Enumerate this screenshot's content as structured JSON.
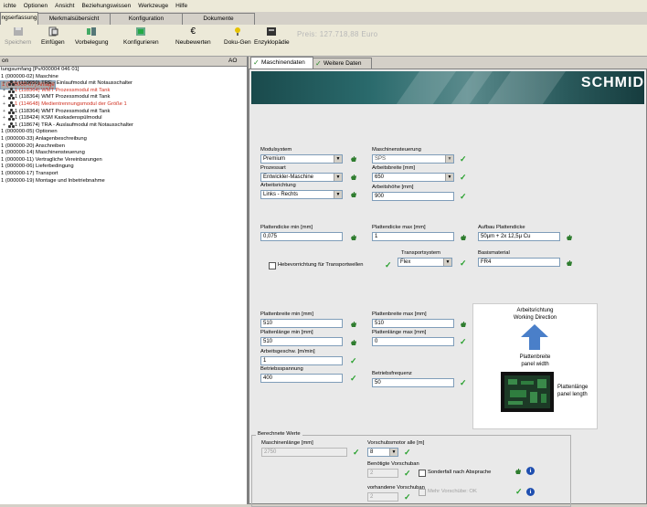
{
  "menu": [
    "ichte",
    "Optionen",
    "Ansicht",
    "Beziehungswissen",
    "Werkzeuge",
    "Hilfe"
  ],
  "top_tabs": [
    "ngserfassung",
    "Merkmalsübersicht",
    "Konfiguration",
    "Dokumente"
  ],
  "toolbar": {
    "buttons": [
      {
        "label": "Speichern",
        "icon": "save-icon",
        "disabled": true
      },
      {
        "label": "Einfügen",
        "icon": "insert-icon",
        "disabled": false
      },
      {
        "label": "Vorbelegung",
        "icon": "preset-icon",
        "disabled": false
      },
      {
        "label": "Konfigurieren",
        "icon": "configure-icon",
        "disabled": false
      },
      {
        "label": "Neubewerten",
        "icon": "euro-icon",
        "disabled": false
      },
      {
        "label": "Doku-Gen",
        "icon": "docgen-icon",
        "disabled": false
      },
      {
        "label": "Enzyklopädie",
        "icon": "encyclopedia-icon",
        "disabled": false
      }
    ],
    "price": "Preis: 127.718,88 Euro"
  },
  "left_pane": {
    "header_left": "on",
    "header_right": "AO",
    "tree": [
      {
        "text": "tungsumfang [Pv/000004 046 01]",
        "indent": 0,
        "expander": "",
        "node_icon": false,
        "red": false,
        "selected": false
      },
      {
        "text": "1 (000000-02) Maschine",
        "indent": 0,
        "expander": "",
        "node_icon": false,
        "red": false,
        "selected": false
      },
      {
        "text": "1 (000000-07) Anlage",
        "indent": 0,
        "expander": "",
        "node_icon": false,
        "red": true,
        "selected": true
      },
      {
        "text": "1 (118659) TRE - Einlaufmodul mit Notausschalter",
        "indent": 1,
        "expander": "+",
        "node_icon": true,
        "red": false,
        "selected": false
      },
      {
        "text": "1 (118364) WMT Prozessmodul mit Tank",
        "indent": 1,
        "expander": "+",
        "node_icon": true,
        "red": true,
        "selected": false
      },
      {
        "text": "1 (118364) WMT Prozessmodul mit Tank",
        "indent": 1,
        "expander": "+",
        "node_icon": true,
        "red": false,
        "selected": false
      },
      {
        "text": "1 (114648) Medientrennungsmodul der Größe 1",
        "indent": 1,
        "expander": "+",
        "node_icon": true,
        "red": true,
        "selected": false
      },
      {
        "text": "1 (118364) WMT Prozessmodul mit Tank",
        "indent": 1,
        "expander": "+",
        "node_icon": true,
        "red": false,
        "selected": false
      },
      {
        "text": "1 (118424) KSM Kaskadenspülmodul",
        "indent": 1,
        "expander": "+",
        "node_icon": true,
        "red": false,
        "selected": false
      },
      {
        "text": "1 (118674) TRA - Auslaufmodul mit Notausschalter",
        "indent": 1,
        "expander": "+",
        "node_icon": true,
        "red": false,
        "selected": false
      },
      {
        "text": "1 (000000-05) Optionen",
        "indent": 0,
        "expander": "",
        "node_icon": false,
        "red": false,
        "selected": false
      },
      {
        "text": "1 (000000-33) Anlagenbeschreibung",
        "indent": 0,
        "expander": "",
        "node_icon": false,
        "red": false,
        "selected": false
      },
      {
        "text": "1 (000000-20) Anschreiben",
        "indent": 0,
        "expander": "",
        "node_icon": false,
        "red": false,
        "selected": false
      },
      {
        "text": "1 (000000-14) Maschinensteuerung",
        "indent": 0,
        "expander": "",
        "node_icon": false,
        "red": false,
        "selected": false
      },
      {
        "text": "1 (000000-11) Vertragliche Vereinbarungen",
        "indent": 0,
        "expander": "",
        "node_icon": false,
        "red": false,
        "selected": false
      },
      {
        "text": "1 (000000-06) Lieferbedingung",
        "indent": 0,
        "expander": "",
        "node_icon": false,
        "red": false,
        "selected": false
      },
      {
        "text": "1 (000000-17) Transport",
        "indent": 0,
        "expander": "",
        "node_icon": false,
        "red": false,
        "selected": false
      },
      {
        "text": "1 (000000-19) Montage und Inbetriebnahme",
        "indent": 0,
        "expander": "",
        "node_icon": false,
        "red": false,
        "selected": false
      }
    ]
  },
  "right_tabs": [
    "Maschinendaten",
    "Weitere Daten"
  ],
  "banner_logo": "SCHMID",
  "form": {
    "modulsystem": {
      "label": "Modulsystem",
      "value": "Premium"
    },
    "maschinensteuerung": {
      "label": "Maschinensteuerung",
      "value": "SPS"
    },
    "prozessart": {
      "label": "Prozessart",
      "value": "Entwickler-Maschine"
    },
    "arbeitsbreite": {
      "label": "Arbeitsbreite [mm]",
      "value": "650"
    },
    "arbeitsrichtung": {
      "label": "Arbeitsrichtung",
      "value": "Links - Rechts"
    },
    "arbeitshoehe": {
      "label": "Arbeitshöhe [mm]",
      "value": "900"
    },
    "plattendicke_min": {
      "label": "Plattendicke min [mm]",
      "value": "0,075"
    },
    "plattendicke_max": {
      "label": "Plattendicke max [mm]",
      "value": "1"
    },
    "aufbau_plattendicke": {
      "label": "Aufbau Plattendicke",
      "value": "50µm + 2x 12,5µ Cu"
    },
    "hebevorrichtung": {
      "label": "Hebevorrichtung für Transportwellen"
    },
    "transportsystem": {
      "label": "Transportsystem",
      "value": "Flex"
    },
    "basismaterial": {
      "label": "Basismaterial",
      "value": "FR4"
    },
    "plattenbreite_min": {
      "label": "Plattenbreite min [mm]",
      "value": "510"
    },
    "plattenbreite_max": {
      "label": "Plattenbreite max [mm]",
      "value": "510"
    },
    "plattenlaenge_min": {
      "label": "Plattenlänge min [mm]",
      "value": "510"
    },
    "plattenlaenge_max": {
      "label": "Plattenlänge max [mm]",
      "value": "0"
    },
    "arbeitsgeschw": {
      "label": "Arbeitsgeschw. [m/min]",
      "value": "1"
    },
    "betriebsspannung": {
      "label": "Betriebsspannung",
      "value": "400"
    },
    "betriebsfrequenz": {
      "label": "Betriebsfrequenz",
      "value": "50"
    }
  },
  "diagram": {
    "title1": "Arbeitsrichtung",
    "title2": "Working Direction",
    "mid1": "Plattenbreite",
    "mid2": "panel width",
    "side1": "Plattenlänge",
    "side2": "panel length"
  },
  "calc": {
    "legend": "Berechnete Werte",
    "maschinenlaenge": {
      "label": "Maschinenlänge [mm]",
      "value": "2750"
    },
    "vorschubsmotor": {
      "label": "Vorschubsmotor alle [m]",
      "value": "8"
    },
    "benoetigte": {
      "label": "Benötigte Vorschuban",
      "value": "2"
    },
    "sonderfall": {
      "label": "Sonderfall nach Absprache"
    },
    "vorhandene": {
      "label": "vorhandene Vorschuban",
      "value": "2"
    },
    "mehr_vorschuebe": {
      "label": "Mehr Vorschübe: OK"
    }
  },
  "colors": {
    "check": "#27a02c",
    "hand": "#2f7d2f",
    "info": "#1f4fb0",
    "red_text": "#d03020",
    "arrow": "#4a7fc9"
  }
}
